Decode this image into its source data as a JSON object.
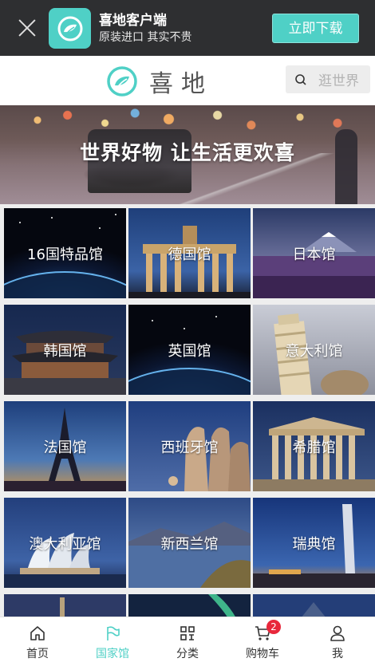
{
  "download_banner": {
    "app_name": "喜地客户端",
    "tagline": "原装进口 其实不贵",
    "button_label": "立即下载"
  },
  "header": {
    "brand_name": "喜地",
    "search_placeholder": "逛世界"
  },
  "hero": {
    "slogan": "世界好物 让生活更欢喜"
  },
  "pavilions": [
    {
      "label": "16国特品馆",
      "theme": "earth-night"
    },
    {
      "label": "德国馆",
      "theme": "brandenburg-gate"
    },
    {
      "label": "日本馆",
      "theme": "mount-fuji"
    },
    {
      "label": "韩国馆",
      "theme": "korean-palace"
    },
    {
      "label": "英国馆",
      "theme": "earth-night"
    },
    {
      "label": "意大利馆",
      "theme": "pisa-tower"
    },
    {
      "label": "法国馆",
      "theme": "eiffel-tower"
    },
    {
      "label": "西班牙馆",
      "theme": "gaudi-chimneys"
    },
    {
      "label": "希腊馆",
      "theme": "parthenon"
    },
    {
      "label": "澳大利亚馆",
      "theme": "sydney-opera-house"
    },
    {
      "label": "新西兰馆",
      "theme": "nz-lake"
    },
    {
      "label": "瑞典馆",
      "theme": "turning-torso"
    }
  ],
  "bottom_nav": {
    "items": [
      {
        "label": "首页",
        "icon": "home-icon",
        "active": false
      },
      {
        "label": "国家馆",
        "icon": "flag-icon",
        "active": true
      },
      {
        "label": "分类",
        "icon": "grid-icon",
        "active": false
      },
      {
        "label": "购物车",
        "icon": "cart-icon",
        "active": false,
        "badge": "2"
      },
      {
        "label": "我",
        "icon": "user-icon",
        "active": false
      }
    ]
  },
  "colors": {
    "accent": "#4fd0c6",
    "banner_bg": "#2e2f31",
    "badge": "#e8273b"
  }
}
